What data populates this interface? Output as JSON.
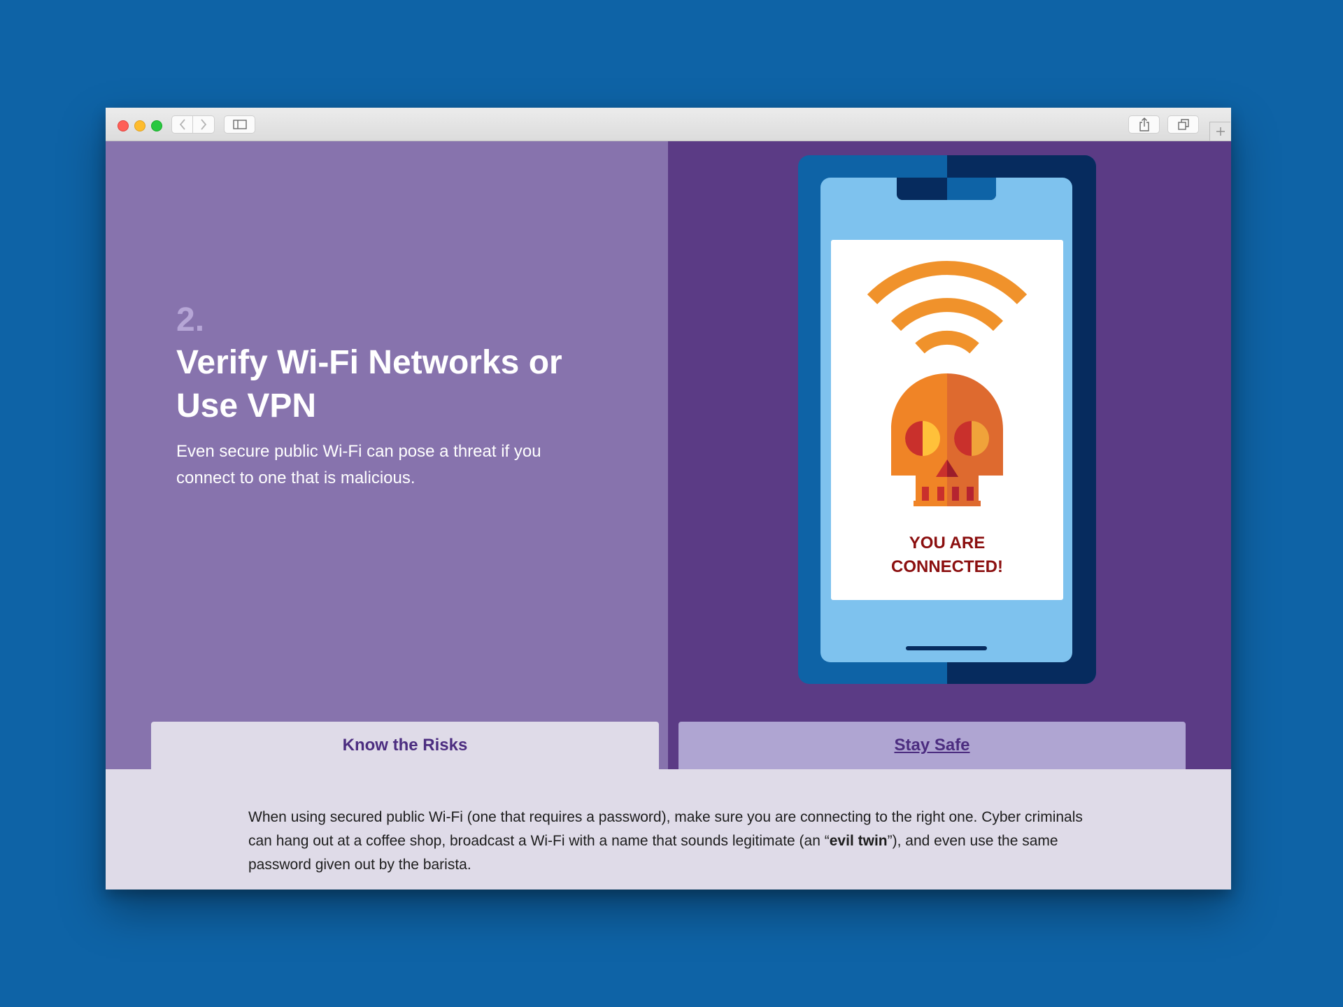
{
  "colors": {
    "page_background": "#0e63a6",
    "left_panel": "#8773ad",
    "right_panel": "#5b3b85",
    "tab_active": "#dfdbe8",
    "tab_inactive": "#afa5d2",
    "accent_text": "#4c2d80",
    "warning_text": "#8b0f0f",
    "wifi_orange": "#f0922b"
  },
  "toolbar": {
    "back_icon": "chevron-left-icon",
    "forward_icon": "chevron-right-icon",
    "sidebar_icon": "sidebar-icon",
    "share_icon": "share-icon",
    "tabs_icon": "tabs-overview-icon",
    "new_tab_icon": "plus-icon"
  },
  "hero": {
    "step_number": "2.",
    "title": "Verify Wi-Fi Networks or Use VPN",
    "subtitle": "Even secure public Wi-Fi can pose a threat if you connect to one that is malicious."
  },
  "illustration": {
    "icons": [
      "wifi-icon",
      "skull-icon"
    ],
    "message_line1": "YOU ARE",
    "message_line2": "CONNECTED!"
  },
  "tabs": [
    {
      "label": "Know the Risks",
      "active": true
    },
    {
      "label": "Stay Safe",
      "active": false
    }
  ],
  "body": {
    "part1": "When using secured public Wi-Fi (one that requires a password), make sure you are connecting to the right one. Cyber criminals can hang out at a coffee shop, broadcast a Wi-Fi with a name that sounds legitimate (an “",
    "bold": "evil twin",
    "part2": "”), and even use the same password given out by the barista."
  }
}
